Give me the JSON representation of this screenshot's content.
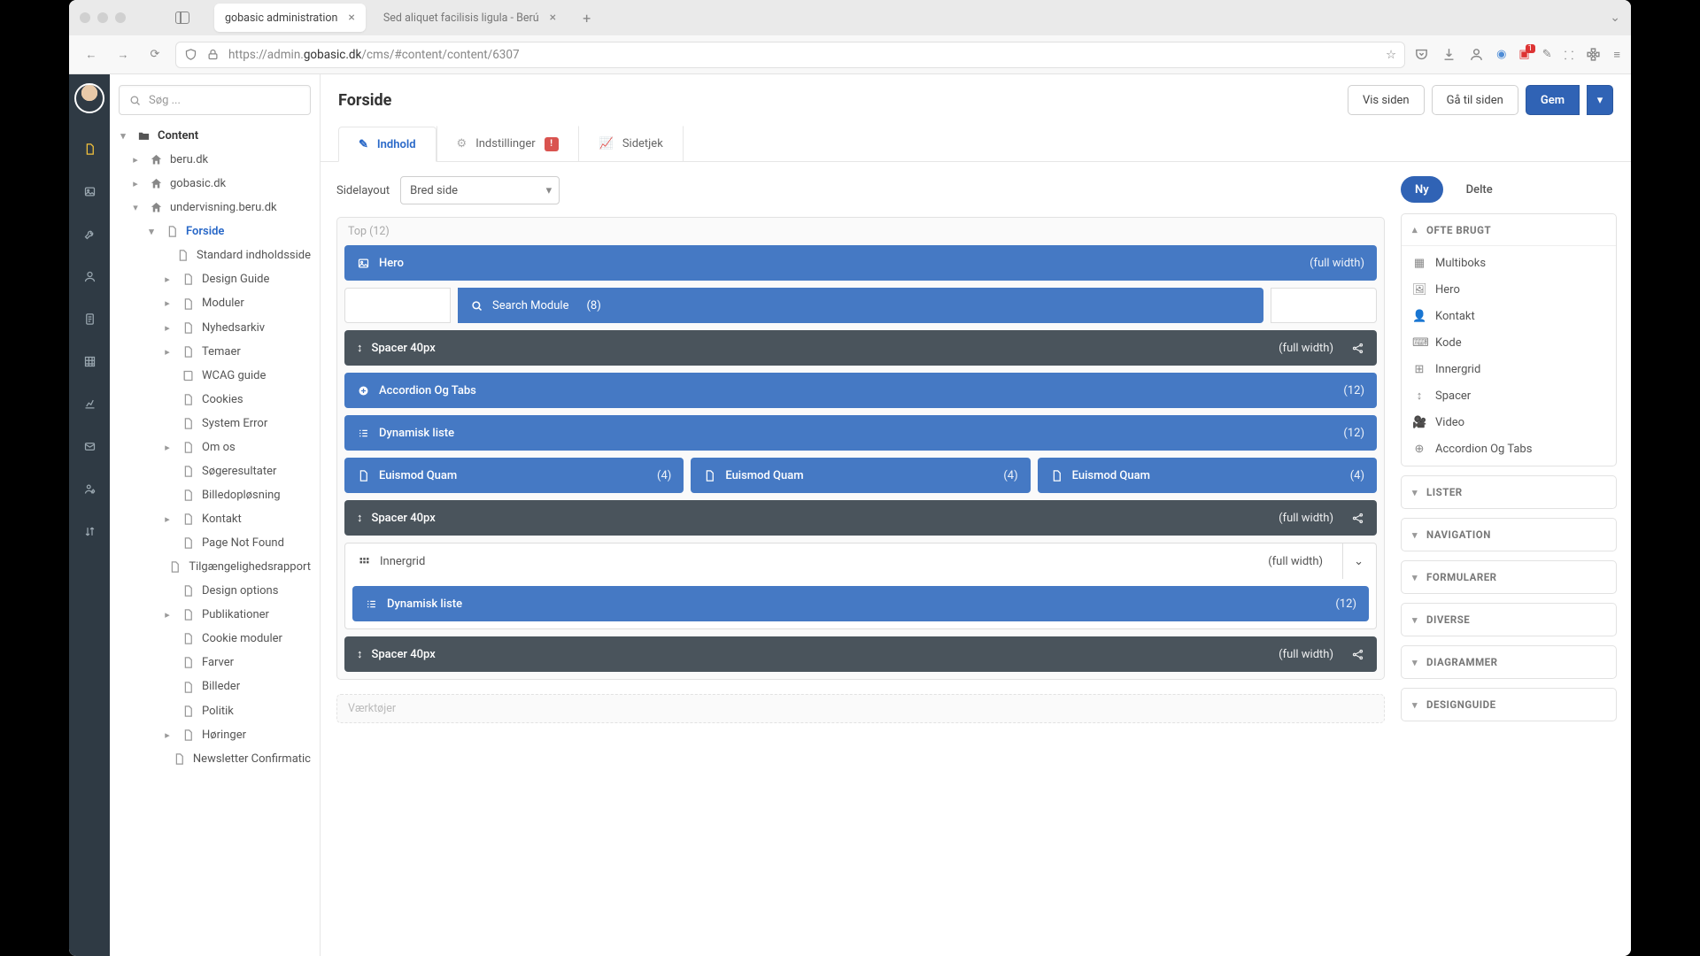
{
  "browser": {
    "tabs": [
      {
        "title": "gobasic administration",
        "active": true
      },
      {
        "title": "Sed aliquet facilisis ligula - Berú",
        "active": false
      }
    ],
    "url_prefix": "https://admin.",
    "url_domain": "gobasic.dk",
    "url_path": "/cms/#content/content/6307",
    "ext_badge": "1"
  },
  "search_placeholder": "Søg ...",
  "tree": [
    {
      "label": "Content",
      "indent": 0,
      "arrow": "▾",
      "icon": "folder",
      "bold": true
    },
    {
      "label": "beru.dk",
      "indent": 1,
      "arrow": "▸",
      "icon": "home"
    },
    {
      "label": "gobasic.dk",
      "indent": 1,
      "arrow": "▸",
      "icon": "home"
    },
    {
      "label": "undervisning.beru.dk",
      "indent": 1,
      "arrow": "▾",
      "icon": "home"
    },
    {
      "label": "Forside",
      "indent": 2,
      "arrow": "▾",
      "icon": "page",
      "active": true
    },
    {
      "label": "Standard indholdsside",
      "indent": 3,
      "arrow": "",
      "icon": "page"
    },
    {
      "label": "Design Guide",
      "indent": 3,
      "arrow": "▸",
      "icon": "page"
    },
    {
      "label": "Moduler",
      "indent": 3,
      "arrow": "▸",
      "icon": "page"
    },
    {
      "label": "Nyhedsarkiv",
      "indent": 3,
      "arrow": "▸",
      "icon": "page"
    },
    {
      "label": "Temaer",
      "indent": 3,
      "arrow": "▸",
      "icon": "page"
    },
    {
      "label": "WCAG guide",
      "indent": 3,
      "arrow": "",
      "icon": "book"
    },
    {
      "label": "Cookies",
      "indent": 3,
      "arrow": "",
      "icon": "page"
    },
    {
      "label": "System Error",
      "indent": 3,
      "arrow": "",
      "icon": "page"
    },
    {
      "label": "Om os",
      "indent": 3,
      "arrow": "▸",
      "icon": "page"
    },
    {
      "label": "Søgeresultater",
      "indent": 3,
      "arrow": "",
      "icon": "page"
    },
    {
      "label": "Billedopløsning",
      "indent": 3,
      "arrow": "",
      "icon": "page"
    },
    {
      "label": "Kontakt",
      "indent": 3,
      "arrow": "▸",
      "icon": "page"
    },
    {
      "label": "Page Not Found",
      "indent": 3,
      "arrow": "",
      "icon": "page"
    },
    {
      "label": "Tilgængelighedsrapport",
      "indent": 3,
      "arrow": "",
      "icon": "page"
    },
    {
      "label": "Design options",
      "indent": 3,
      "arrow": "",
      "icon": "page"
    },
    {
      "label": "Publikationer",
      "indent": 3,
      "arrow": "▸",
      "icon": "page"
    },
    {
      "label": "Cookie moduler",
      "indent": 3,
      "arrow": "",
      "icon": "page"
    },
    {
      "label": "Farver",
      "indent": 3,
      "arrow": "",
      "icon": "page"
    },
    {
      "label": "Billeder",
      "indent": 3,
      "arrow": "",
      "icon": "page"
    },
    {
      "label": "Politik",
      "indent": 3,
      "arrow": "",
      "icon": "page"
    },
    {
      "label": "Høringer",
      "indent": 3,
      "arrow": "▸",
      "icon": "page"
    },
    {
      "label": "Newsletter Confirmatic",
      "indent": 3,
      "arrow": "",
      "icon": "page"
    }
  ],
  "page_title": "Forside",
  "header_buttons": {
    "view": "Vis siden",
    "goto": "Gå til siden",
    "save": "Gem"
  },
  "tabs": {
    "content": "Indhold",
    "settings": "Indstillinger",
    "settings_badge": "!",
    "check": "Sidetjek"
  },
  "layout": {
    "label": "Sidelayout",
    "value": "Bred side"
  },
  "sections": {
    "top": "Top (12)",
    "tools": "Værktøjer"
  },
  "blocks": {
    "hero": {
      "label": "Hero",
      "meta": "(full width)"
    },
    "search": {
      "label": "Search Module",
      "meta": "(8)"
    },
    "spacer": {
      "label": "Spacer 40px",
      "meta": "(full width)"
    },
    "accordion": {
      "label": "Accordion Og Tabs",
      "meta": "(12)"
    },
    "dynlist": {
      "label": "Dynamisk liste",
      "meta": "(12)"
    },
    "euismod": {
      "label": "Euismod Quam",
      "meta": "(4)"
    },
    "innergrid": {
      "label": "Innergrid",
      "meta": "(full width)"
    }
  },
  "side": {
    "pill_new": "Ny",
    "pill_shared": "Delte",
    "often": "OFTE BRUGT",
    "items": [
      {
        "icon": "grid",
        "label": "Multiboks"
      },
      {
        "icon": "image",
        "label": "Hero"
      },
      {
        "icon": "user",
        "label": "Kontakt"
      },
      {
        "icon": "code",
        "label": "Kode"
      },
      {
        "icon": "grid4",
        "label": "Innergrid"
      },
      {
        "icon": "spacer",
        "label": "Spacer"
      },
      {
        "icon": "video",
        "label": "Video"
      },
      {
        "icon": "plus",
        "label": "Accordion Og Tabs"
      }
    ],
    "groups": [
      "LISTER",
      "NAVIGATION",
      "FORMULARER",
      "DIVERSE",
      "DIAGRAMMER",
      "DESIGNGUIDE"
    ]
  }
}
